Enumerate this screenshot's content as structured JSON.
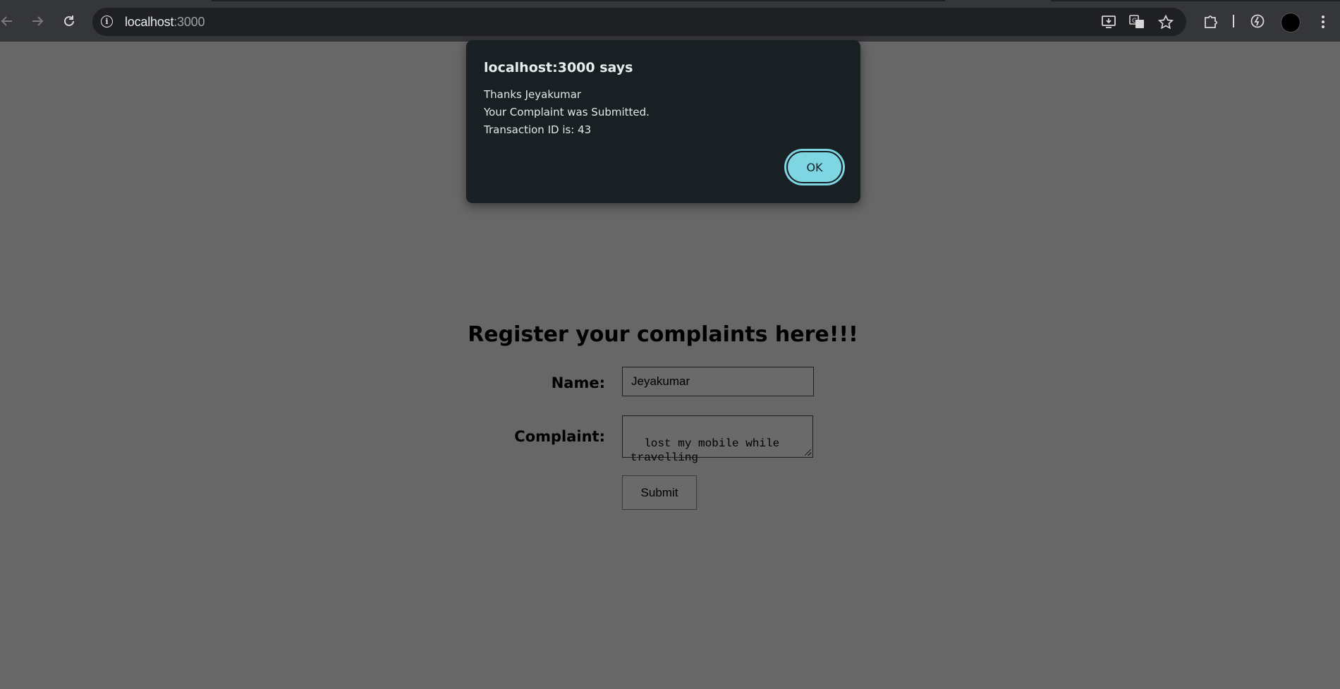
{
  "browser": {
    "url_host": "localhost",
    "url_port": ":3000",
    "icons": {
      "back": "arrow-left-icon",
      "forward": "arrow-right-icon",
      "reload": "reload-icon",
      "site_info": "info-icon",
      "install": "install-app-icon",
      "translate": "translate-icon",
      "bookmark": "star-icon",
      "extensions": "puzzle-icon",
      "performance": "performance-icon",
      "profile": "avatar",
      "menu": "kebab-menu-icon"
    }
  },
  "dialog": {
    "title": "localhost:3000 says",
    "lines": [
      "Thanks Jeyakumar",
      "Your Complaint was Submitted.",
      "Transaction ID is: 43"
    ],
    "ok_label": "OK"
  },
  "form": {
    "heading": "Register your complaints here!!!",
    "name_label": "Name:",
    "name_value": "Jeyakumar",
    "complaint_label": "Complaint:",
    "complaint_value": "lost my mobile while\ntravelling",
    "submit_label": "Submit"
  },
  "colors": {
    "overlay_background": "#676767",
    "dialog_background": "#192024",
    "ok_button": "#7fd6e3",
    "toolbar": "#35363a"
  }
}
